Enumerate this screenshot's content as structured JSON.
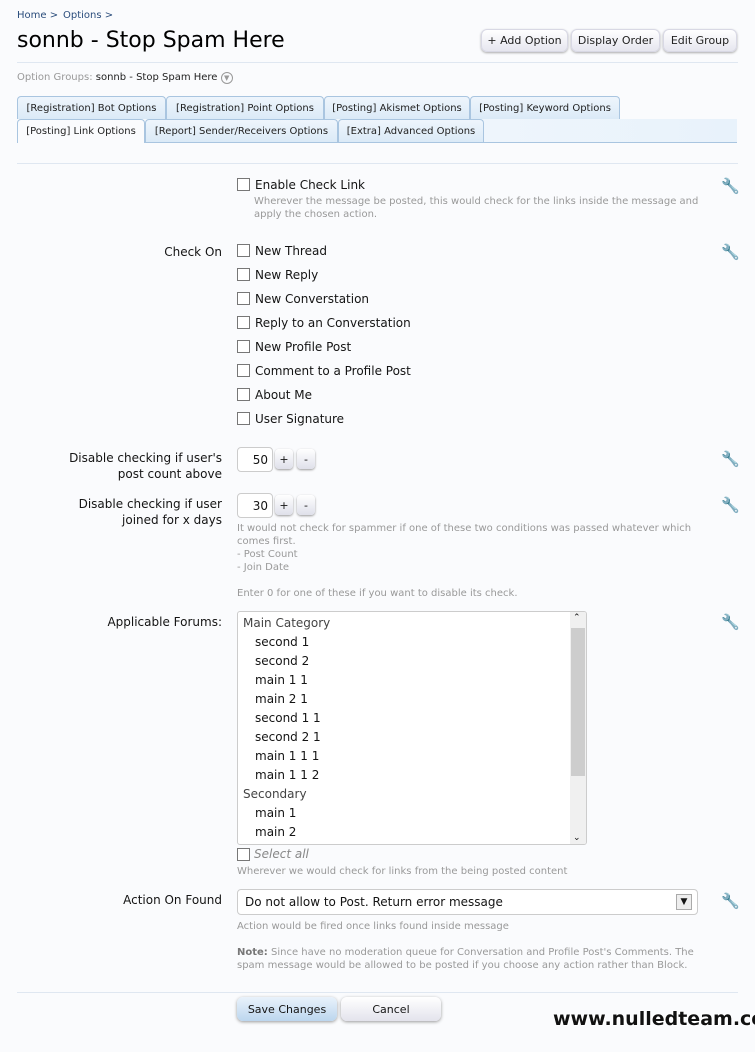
{
  "breadcrumb": [
    "Home >",
    "Options >"
  ],
  "title": "sonnb - Stop Spam Here",
  "header_buttons": [
    "+ Add Option",
    "Display Order",
    "Edit Group"
  ],
  "option_groups": {
    "label": "Option Groups:",
    "value": "sonnb - Stop Spam Here"
  },
  "tabs_row1": [
    "[Registration] Bot Options",
    "[Registration] Point Options",
    "[Posting] Akismet Options",
    "[Posting] Keyword Options"
  ],
  "tabs_row2": [
    "[Posting] Link Options",
    "[Report] Sender/Receivers Options",
    "[Extra] Advanced Options"
  ],
  "active_tab": "[Posting] Link Options",
  "enable": {
    "label": "Enable Check Link",
    "checked": false,
    "hint": "Wherever the message be posted, this would check for the links inside the message and apply the chosen action."
  },
  "check_on": {
    "label": "Check On",
    "items": [
      "New Thread",
      "New Reply",
      "New Converstation",
      "Reply to an Converstation",
      "New Profile Post",
      "Comment to a Profile Post",
      "About Me",
      "User Signature"
    ]
  },
  "post_count": {
    "label1": "Disable checking if user's",
    "label2": "post count above",
    "value": "50"
  },
  "join_days": {
    "label1": "Disable checking if user",
    "label2": "joined for x days",
    "value": "30",
    "hint": [
      "It would not check for spammer if one of these two conditions was passed whatever which",
      "comes first.",
      "- Post Count",
      "- Join Date",
      "Enter 0 for one of these if you want to disable its check."
    ]
  },
  "forums": {
    "label": "Applicable Forums:",
    "items": [
      {
        "t": "Main Category",
        "g": true
      },
      {
        "t": "second 1"
      },
      {
        "t": "second 2"
      },
      {
        "t": "main 1 1"
      },
      {
        "t": "main 2 1"
      },
      {
        "t": "second 1 1"
      },
      {
        "t": "second 2 1"
      },
      {
        "t": "main 1 1 1"
      },
      {
        "t": "main 1 1 2"
      },
      {
        "t": "Secondary",
        "g": true
      },
      {
        "t": "main 1"
      },
      {
        "t": "main 2"
      }
    ],
    "select_all": "Select all",
    "hint": "Wherever we would check for links from the being posted content"
  },
  "action": {
    "label": "Action On Found",
    "value": "Do not allow to Post. Return error message",
    "hint": "Action would be fired once links found inside message",
    "note_label": "Note:",
    "note1": "Since have no moderation queue for Conversation and Profile Post's Comments. The",
    "note2": "spam message would be allowed to be posted if you choose any action rather than Block."
  },
  "buttons": {
    "save": "Save Changes",
    "cancel": "Cancel"
  },
  "watermark": "www.nulledteam.com"
}
